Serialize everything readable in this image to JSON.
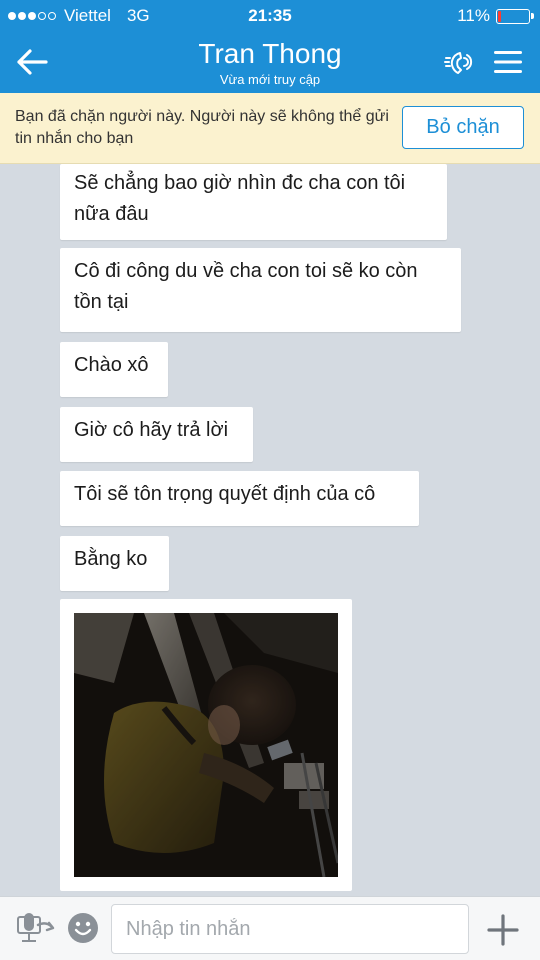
{
  "status_bar": {
    "carrier": "Viettel",
    "network": "3G",
    "time": "21:35",
    "battery": "11%",
    "battery_level": 0.11,
    "signal_bars_filled": 3,
    "signal_bars_total": 5
  },
  "header": {
    "title": "Tran Thong",
    "subtitle": "Vừa mới truy cập",
    "icons": [
      "back-arrow-icon",
      "call-icon",
      "menu-icon"
    ]
  },
  "blocked_banner": {
    "text": "Bạn đã chặn người này. Người này sẽ không thể gửi tin nhắn cho bạn",
    "unblock_label": "Bỏ chặn"
  },
  "messages": [
    {
      "text": "Sẽ chẳng bao giờ nhìn đc cha con tôi nữa đâu"
    },
    {
      "text": "Cô đi công du về cha con toi sẽ ko còn tồn tại"
    },
    {
      "text": "Chào xô"
    },
    {
      "text": "Giờ cô hãy trả lời"
    },
    {
      "text": "Tôi sẽ tôn trọng quyết định của cô"
    },
    {
      "text": "Bằng ko"
    }
  ],
  "photo_message": {
    "description_icon": "photo-thumbnail"
  },
  "input_bar": {
    "placeholder": "Nhập tin nhắn",
    "value": ""
  },
  "colors": {
    "primary": "#1d8fd6",
    "banner_bg": "#fbf2cf",
    "chat_bg": "#d4dae1",
    "bubble_bg": "#ffffff",
    "battery_low": "#ff3b30"
  }
}
